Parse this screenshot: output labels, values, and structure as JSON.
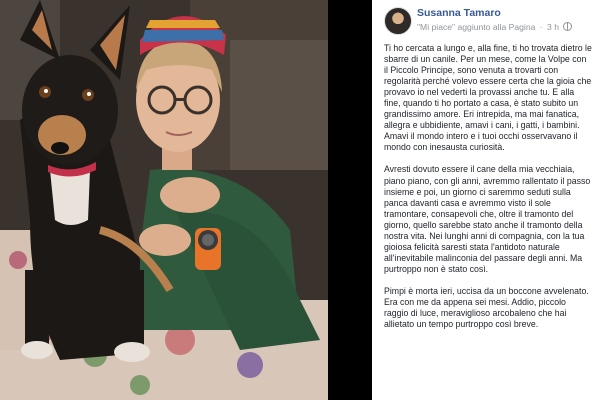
{
  "post": {
    "author": "Susanna Tamaro",
    "meta_action": "\"Mi piace\" aggiunto alla Pagina",
    "meta_separator": "·",
    "meta_time": "3 h",
    "paragraphs": [
      "Ti ho cercata a lungo e, alla fine, ti ho trovata dietro le sbarre di un canile. Per un mese, come la Volpe con il Piccolo Principe, sono venuta a trovarti con regolarità perché volevo essere certa che la gioia che provavo io nel vederti la provassi anche tu. E alla fine, quando ti ho portato a casa, è stato subito un grandissimo amore. Eri intrepida, ma mai fanatica, allegra e ubbidiente, amavi i cani, i gatti, i bambini. Amavi il mondo intero e i tuoi occhi osservavano il mondo con inesausta curiosità.",
      "Avresti dovuto essere il cane della mia vecchiaia, piano piano, con gli anni, avremmo rallentato il passo insieme e poi, un giorno ci saremmo seduti sulla panca davanti casa e avremmo visto il sole tramontare, consapevoli che, oltre il tramonto del giorno, quello sarebbe stato anche il tramonto della nostra vita. Nei lunghi anni di compagnia, con la tua gioiosa felicità saresti stata l'antidoto naturale all'inevitabile malinconia del passare degli anni. Ma purtroppo non è stato così.",
      "Pimpi è morta ieri, uccisa da un boccone avvelenato. Era con me da appena sei mesi. Addio, piccolo raggio di luce, meraviglioso arcobaleno che hai allietato un tempo purtroppo così breve."
    ]
  },
  "colors": {
    "author_link": "#385898",
    "meta_text": "#90949c",
    "body_text": "#1d2129",
    "watch_strap": "#e8742a"
  },
  "icons": [
    "avatar",
    "globe-icon"
  ]
}
